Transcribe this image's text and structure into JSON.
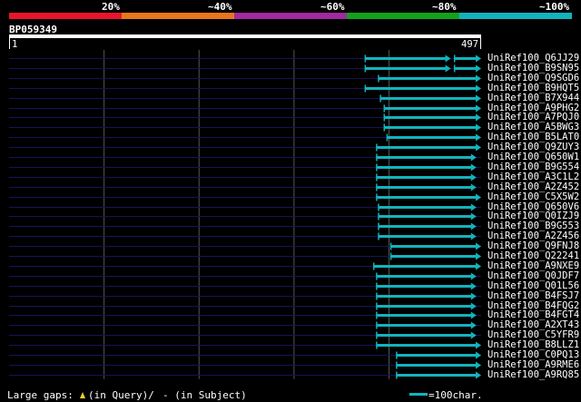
{
  "legend": {
    "labels": [
      "20%",
      "~40%",
      "~60%",
      "~80%",
      "~100%"
    ],
    "colors": [
      "#e8152b",
      "#e8761a",
      "#a02a9e",
      "#13a21b",
      "#13b3bd"
    ]
  },
  "query": {
    "name": "BP059349",
    "start": "1",
    "end": "497",
    "length": 497
  },
  "hits": [
    {
      "name": "UniRef100_Q6JJ29",
      "segments": [
        [
          375,
          465
        ],
        [
          469,
          497
        ]
      ],
      "color": "#13b3bd"
    },
    {
      "name": "UniRef100_B9SN95",
      "segments": [
        [
          375,
          465
        ],
        [
          469,
          497
        ]
      ],
      "color": "#13b3bd"
    },
    {
      "name": "UniRef100_Q9SGD6",
      "segments": [
        [
          389,
          497
        ]
      ],
      "color": "#13b3bd"
    },
    {
      "name": "UniRef100_B9HQT5",
      "segments": [
        [
          375,
          497
        ]
      ],
      "color": "#13b3bd"
    },
    {
      "name": "UniRef100_B7X944",
      "segments": [
        [
          391,
          497
        ]
      ],
      "color": "#13b3bd"
    },
    {
      "name": "UniRef100_A9PHG2",
      "segments": [
        [
          395,
          497
        ]
      ],
      "color": "#13b3bd"
    },
    {
      "name": "UniRef100_A7PQJ0",
      "segments": [
        [
          395,
          497
        ]
      ],
      "color": "#13b3bd"
    },
    {
      "name": "UniRef100_A5BWG3",
      "segments": [
        [
          395,
          497
        ]
      ],
      "color": "#13b3bd"
    },
    {
      "name": "UniRef100_B5LAT0",
      "segments": [
        [
          398,
          497
        ]
      ],
      "color": "#13b3bd"
    },
    {
      "name": "UniRef100_Q9ZUY3",
      "segments": [
        [
          387,
          497
        ]
      ],
      "color": "#13b3bd"
    },
    {
      "name": "UniRef100_Q650W1",
      "segments": [
        [
          387,
          492
        ]
      ],
      "color": "#13b3bd"
    },
    {
      "name": "UniRef100_B9G554",
      "segments": [
        [
          387,
          492
        ]
      ],
      "color": "#13b3bd"
    },
    {
      "name": "UniRef100_A3C1L2",
      "segments": [
        [
          387,
          492
        ]
      ],
      "color": "#13b3bd"
    },
    {
      "name": "UniRef100_A2Z452",
      "segments": [
        [
          387,
          492
        ]
      ],
      "color": "#13b3bd"
    },
    {
      "name": "UniRef100_C5X5W2",
      "segments": [
        [
          387,
          497
        ]
      ],
      "color": "#13b3bd"
    },
    {
      "name": "UniRef100_Q650V6",
      "segments": [
        [
          389,
          492
        ]
      ],
      "color": "#13b3bd"
    },
    {
      "name": "UniRef100_Q0IZJ9",
      "segments": [
        [
          389,
          492
        ]
      ],
      "color": "#13b3bd"
    },
    {
      "name": "UniRef100_B9G553",
      "segments": [
        [
          389,
          492
        ]
      ],
      "color": "#13b3bd"
    },
    {
      "name": "UniRef100_A2Z456",
      "segments": [
        [
          389,
          492
        ]
      ],
      "color": "#13b3bd"
    },
    {
      "name": "UniRef100_Q9FNJ8",
      "segments": [
        [
          402,
          497
        ]
      ],
      "color": "#13b3bd"
    },
    {
      "name": "UniRef100_Q22241",
      "segments": [
        [
          402,
          497
        ]
      ],
      "color": "#13b3bd"
    },
    {
      "name": "UniRef100_A9NXE9",
      "segments": [
        [
          384,
          497
        ]
      ],
      "color": "#13b3bd"
    },
    {
      "name": "UniRef100_Q0JDF7",
      "segments": [
        [
          387,
          492
        ]
      ],
      "color": "#13b3bd"
    },
    {
      "name": "UniRef100_Q01L56",
      "segments": [
        [
          387,
          492
        ]
      ],
      "color": "#13b3bd"
    },
    {
      "name": "UniRef100_B4FSJ7",
      "segments": [
        [
          387,
          492
        ]
      ],
      "color": "#13b3bd"
    },
    {
      "name": "UniRef100_B4FQG2",
      "segments": [
        [
          387,
          492
        ]
      ],
      "color": "#13b3bd"
    },
    {
      "name": "UniRef100_B4FGT4",
      "segments": [
        [
          387,
          492
        ]
      ],
      "color": "#13b3bd"
    },
    {
      "name": "UniRef100_A2XT43",
      "segments": [
        [
          387,
          492
        ]
      ],
      "color": "#13b3bd"
    },
    {
      "name": "UniRef100_C5YFR9",
      "segments": [
        [
          387,
          492
        ]
      ],
      "color": "#13b3bd"
    },
    {
      "name": "UniRef100_B8LLZ1",
      "segments": [
        [
          387,
          497
        ]
      ],
      "color": "#13b3bd"
    },
    {
      "name": "UniRef100_C0PQ13",
      "segments": [
        [
          408,
          497
        ]
      ],
      "color": "#13b3bd"
    },
    {
      "name": "UniRef100_A9RME6",
      "segments": [
        [
          408,
          497
        ]
      ],
      "color": "#13b3bd"
    },
    {
      "name": "UniRef100_A9RQ85",
      "segments": [
        [
          408,
          497
        ]
      ],
      "color": "#13b3bd"
    }
  ],
  "footer": {
    "gaps_label": "Large gaps:",
    "query_gap_text": "(in Query)/",
    "subject_gap_text": "- (in Subject)",
    "scale_text": "=100char.",
    "scale_chars": 100
  },
  "colors": {
    "background": "#000000",
    "track": "#14145a",
    "grid": "#555555",
    "hit": "#13b3bd"
  }
}
